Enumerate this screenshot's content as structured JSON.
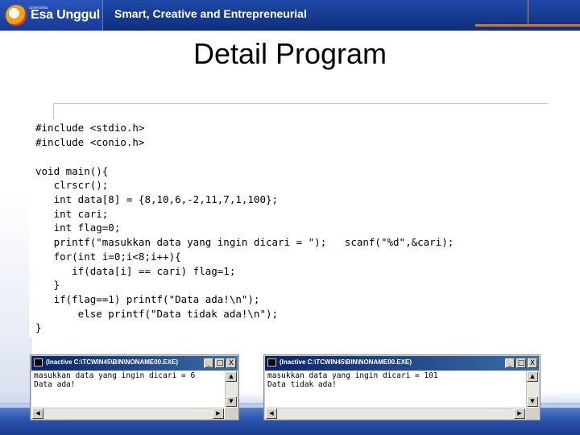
{
  "header": {
    "university_tiny": "universitas",
    "brand": "Esa Unggul",
    "tagline": "Smart, Creative and Entrepreneurial"
  },
  "title": "Detail Program",
  "code": {
    "lines": [
      "#include <stdio.h>",
      "#include <conio.h>",
      "",
      "void main(){",
      "   clrscr();",
      "   int data[8] = {8,10,6,-2,11,7,1,100};",
      "   int cari;",
      "   int flag=0;",
      "   printf(\"masukkan data yang ingin dicari = \");   scanf(\"%d\",&cari);",
      "   for(int i=0;i<8;i++){",
      "      if(data[i] == cari) flag=1;",
      "   }",
      "   if(flag==1) printf(\"Data ada!\\n\");",
      "       else printf(\"Data tidak ada!\\n\");",
      "}"
    ]
  },
  "consoles": [
    {
      "title": "(Inactive C:\\TCWIN45\\BIN\\NONAME00.EXE)",
      "lines": [
        "masukkan data yang ingin dicari = 6",
        "Data ada!"
      ],
      "minimize": "_",
      "maximize": "□",
      "close": "X"
    },
    {
      "title": "(Inactive C:\\TCWIN45\\BIN\\NONAME00.EXE)",
      "lines": [
        "masukkan data yang ingin dicari = 101",
        "Data tidak ada!"
      ],
      "minimize": "_",
      "maximize": "□",
      "close": "X"
    }
  ],
  "colors": {
    "banner": "#163a8f",
    "accent": "#d9731e",
    "titlebar": "#0a246a"
  },
  "icons": {
    "scroll_up": "▲",
    "scroll_down": "▼",
    "scroll_left": "◀",
    "scroll_right": "▶"
  }
}
